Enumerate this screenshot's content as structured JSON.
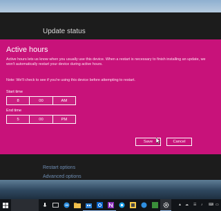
{
  "settings": {
    "title": "Update status",
    "links": [
      "Restart options",
      "Advanced options"
    ]
  },
  "dialog": {
    "heading": "Active hours",
    "description": "Active hours lets us know when you usually use this device. When a restart is necessary to finish installing an update, we won't automatically restart your device during active hours.",
    "note": "Note: We'll check to see if you're using this device before attempting to restart.",
    "start_label": "Start time",
    "start": {
      "hour": "8",
      "minute": "00",
      "period": "AM"
    },
    "end_label": "End time",
    "end": {
      "hour": "5",
      "minute": "00",
      "period": "PM"
    },
    "save_label": "Save",
    "cancel_label": "Cancel"
  },
  "colors": {
    "dialog_accent": "#c8127a",
    "settings_bg": "#1c1c1c",
    "taskbar_bg": "#111418"
  },
  "taskbar": {
    "icons": [
      "windows-start-icon",
      "search-icon",
      "microphone-icon",
      "task-view-icon",
      "edge-icon",
      "file-explorer-icon",
      "store-icon",
      "outlook-icon",
      "onenote-icon",
      "skype-icon",
      "settings-icon"
    ],
    "tray_icons": [
      "notification-icon",
      "onedrive-icon",
      "wifi-icon",
      "volume-icon",
      "keyboard-icon",
      "action-center-icon"
    ]
  }
}
